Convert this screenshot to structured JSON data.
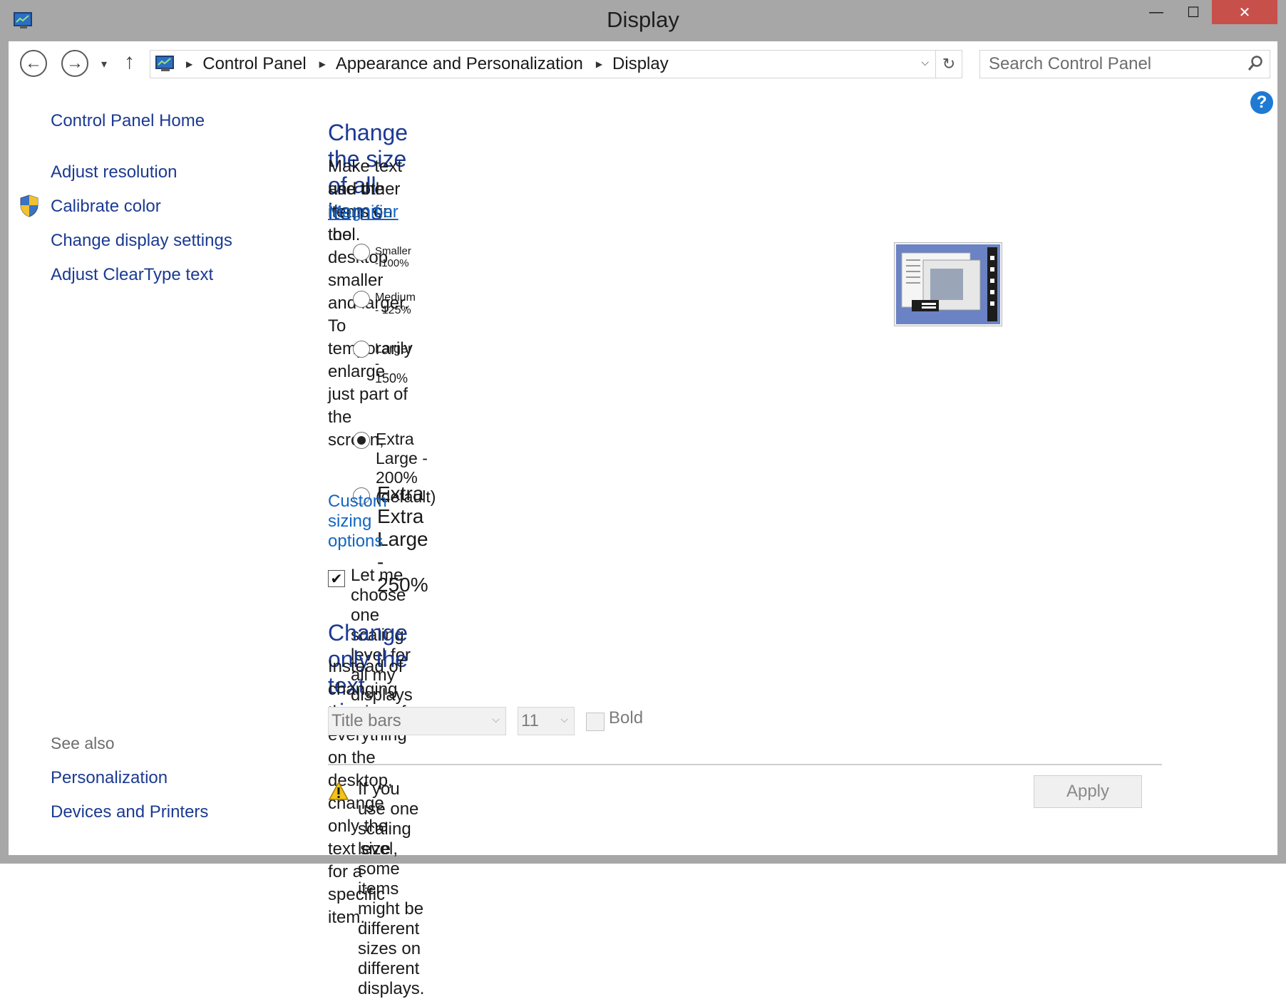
{
  "window": {
    "title": "Display",
    "controls": {
      "minimize": "—",
      "maximize": "☐",
      "close": "✕"
    }
  },
  "nav": {
    "back": "←",
    "forward": "→",
    "recent": "▾",
    "up": "↑",
    "breadcrumb": [
      "Control Panel",
      "Appearance and Personalization",
      "Display"
    ],
    "refresh": "↻",
    "search_placeholder": "Search Control Panel",
    "help": "?"
  },
  "sidebar": {
    "home": "Control Panel Home",
    "items": [
      "Adjust resolution",
      "Calibrate color",
      "Change display settings",
      "Adjust ClearType text"
    ],
    "see_also_label": "See also",
    "see_also": [
      "Personalization",
      "Devices and Printers"
    ]
  },
  "main": {
    "heading1": "Change the size of all items",
    "para1_a": "Make text and other items on the desktop smaller and larger. To temporarily enlarge just part of the screen,",
    "para1_b_prefix": "use the ",
    "magnifier": "Magnifier",
    "para1_b_suffix": " tool.",
    "options": [
      {
        "label": "Smaller - 100%",
        "checked": false
      },
      {
        "label": "Medium - 125%",
        "checked": false
      },
      {
        "label": "Larger - 150%",
        "checked": false
      },
      {
        "label": "Extra Large - 200% (default)",
        "checked": true
      },
      {
        "label": "Extra Extra Large - 250%",
        "checked": false
      }
    ],
    "custom_link": "Custom sizing options",
    "checkbox_label": "Let me choose one scaling level for all my displays",
    "checkbox_checked": true,
    "heading2": "Change only the text size",
    "para2": "Instead of changing the size of everything on the desktop, change only the text size for a specific item.",
    "item_select": "Title bars",
    "size_select": "11",
    "bold_label": "Bold",
    "warning": "If you use one scaling level, some items might be different sizes on different displays.",
    "apply": "Apply"
  }
}
